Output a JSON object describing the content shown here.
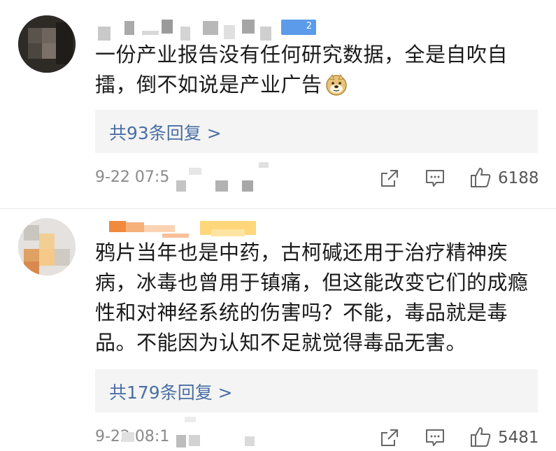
{
  "comments": [
    {
      "badge": "2",
      "text_line1": "一份产业报告没有任何研究数据，全是自吹自",
      "text_line2": "擂，倒不如说是产业广告",
      "emoji": "doge-emoji",
      "replies_label": "共93条回复 >",
      "time": "9-22 07:5",
      "likes": "6188",
      "icons": [
        "share-icon",
        "comment-icon",
        "like-icon"
      ]
    },
    {
      "text_line1": "鸦片当年也是中药，古柯碱还用于治疗精神疾",
      "text_line2": "病，冰毒也曾用于镇痛，但这能改变它们的成瘾",
      "text_line3": "性和对神经系统的伤害吗？不能，毒品就是毒",
      "text_line4": "品。不能因为认知不足就觉得毒品无害。",
      "replies_label": "共179条回复 >",
      "time": "9-22 08:1",
      "likes": "5481",
      "icons": [
        "share-icon",
        "comment-icon",
        "like-icon"
      ]
    }
  ],
  "colors": {
    "link": "#4a6fa5",
    "meta": "#8a8a8a",
    "reply_bg": "#f4f4f4"
  }
}
